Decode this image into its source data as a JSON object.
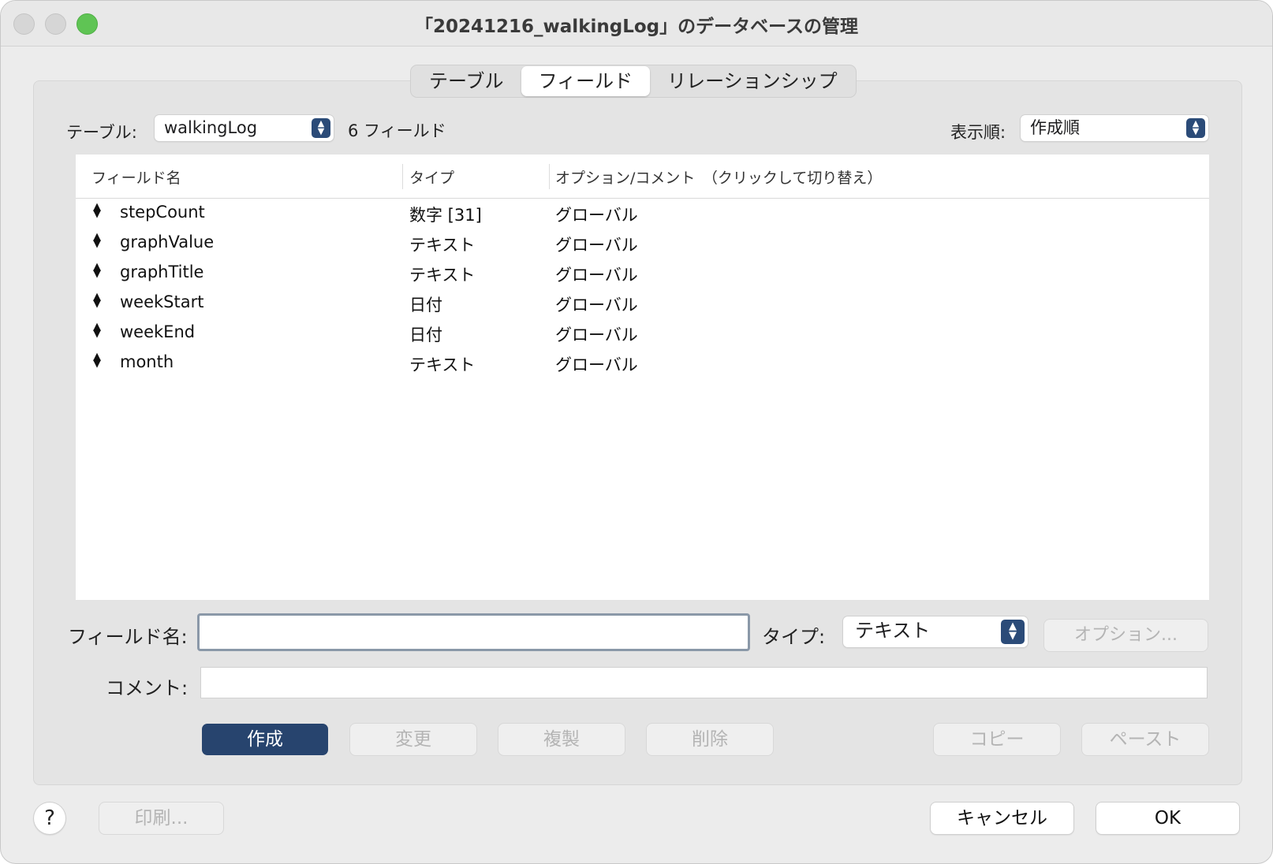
{
  "window": {
    "title": "「20241216_walkingLog」のデータベースの管理"
  },
  "tabs": [
    {
      "label": "テーブル",
      "active": false
    },
    {
      "label": "フィールド",
      "active": true
    },
    {
      "label": "リレーションシップ",
      "active": false
    }
  ],
  "toolbar": {
    "table_label": "テーブル:",
    "table_value": "walkingLog",
    "field_count": "6 フィールド",
    "order_label": "表示順:",
    "order_value": "作成順"
  },
  "table": {
    "headers": [
      "フィールド名",
      "タイプ",
      "オプション/コメント　（クリックして切り替え）"
    ],
    "rows": [
      {
        "name": "stepCount",
        "type": "数字 [31]",
        "option": "グローバル"
      },
      {
        "name": "graphValue",
        "type": "テキスト",
        "option": "グローバル"
      },
      {
        "name": "graphTitle",
        "type": "テキスト",
        "option": "グローバル"
      },
      {
        "name": "weekStart",
        "type": "日付",
        "option": "グローバル"
      },
      {
        "name": "weekEnd",
        "type": "日付",
        "option": "グローバル"
      },
      {
        "name": "month",
        "type": "テキスト",
        "option": "グローバル"
      }
    ]
  },
  "form": {
    "field_name_label": "フィールド名:",
    "field_name_value": "",
    "type_label": "タイプ:",
    "type_value": "テキスト",
    "options_button": "オプション...",
    "comment_label": "コメント:",
    "comment_value": ""
  },
  "actions": {
    "create": "作成",
    "change": "変更",
    "duplicate": "複製",
    "delete": "削除",
    "copy": "コピー",
    "paste": "ペースト"
  },
  "footer": {
    "help": "?",
    "print": "印刷...",
    "cancel": "キャンセル",
    "ok": "OK"
  },
  "colors": {
    "primary_button": "#27446e",
    "traffic_green": "#5fc454",
    "focus_ring": "#8a98a8"
  }
}
